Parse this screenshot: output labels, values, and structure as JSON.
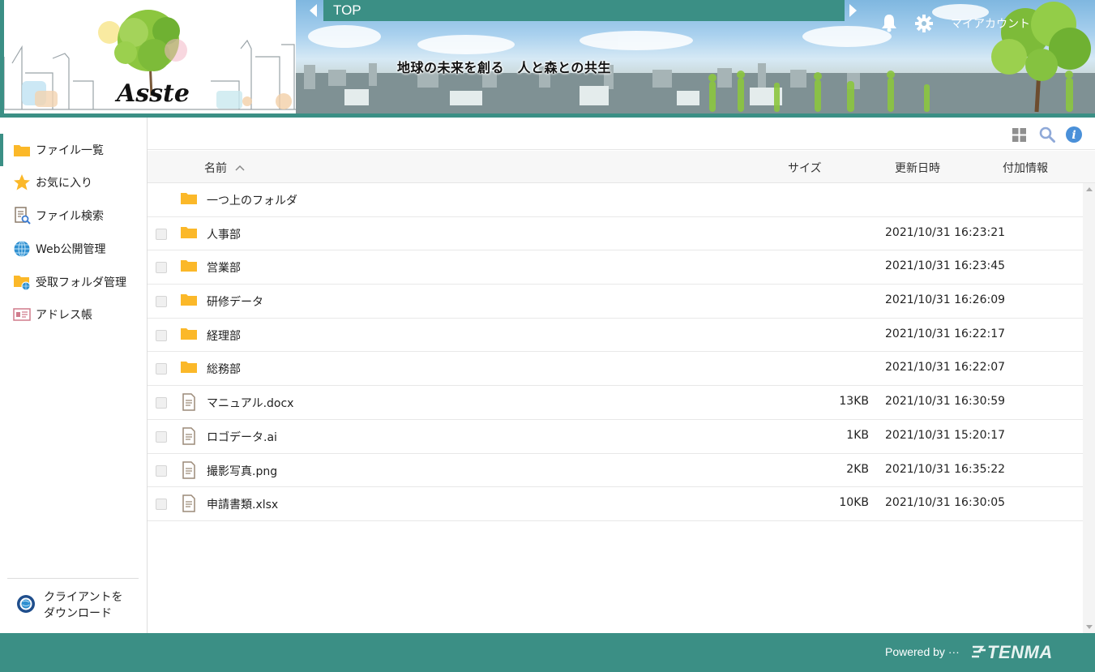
{
  "header": {
    "logo_text": "Asste",
    "nav_title": "TOP",
    "slogan": "地球の未来を創る　人と森との共生",
    "account_label": "マイアカウント"
  },
  "sidebar": {
    "items": [
      {
        "label": "ファイル一覧",
        "icon": "folder-icon"
      },
      {
        "label": "お気に入り",
        "icon": "star-icon"
      },
      {
        "label": "ファイル検索",
        "icon": "file-search-icon"
      },
      {
        "label": "Web公開管理",
        "icon": "globe-icon"
      },
      {
        "label": "受取フォルダ管理",
        "icon": "receive-folder-icon"
      },
      {
        "label": "アドレス帳",
        "icon": "address-card-icon"
      }
    ],
    "download_line1": "クライアントを",
    "download_line2": "ダウンロード"
  },
  "table": {
    "columns": {
      "name": "名前",
      "size": "サイズ",
      "date": "更新日時",
      "extra": "付加情報"
    },
    "parent_folder": "一つ上のフォルダ",
    "rows": [
      {
        "name": "人事部",
        "type": "folder",
        "size": "",
        "date": "2021/10/31 16:23:21"
      },
      {
        "name": "営業部",
        "type": "folder",
        "size": "",
        "date": "2021/10/31 16:23:45"
      },
      {
        "name": "研修データ",
        "type": "folder",
        "size": "",
        "date": "2021/10/31 16:26:09"
      },
      {
        "name": "経理部",
        "type": "folder",
        "size": "",
        "date": "2021/10/31 16:22:17"
      },
      {
        "name": "総務部",
        "type": "folder",
        "size": "",
        "date": "2021/10/31 16:22:07"
      },
      {
        "name": "マニュアル.docx",
        "type": "file",
        "size": "13KB",
        "date": "2021/10/31 16:30:59"
      },
      {
        "name": "ロゴデータ.ai",
        "type": "file",
        "size": "1KB",
        "date": "2021/10/31 15:20:17"
      },
      {
        "name": "撮影写真.png",
        "type": "file",
        "size": "2KB",
        "date": "2021/10/31 16:35:22"
      },
      {
        "name": "申請書類.xlsx",
        "type": "file",
        "size": "10KB",
        "date": "2021/10/31 16:30:05"
      }
    ]
  },
  "footer": {
    "powered_by": "Powered by ···",
    "brand": "TENMA"
  },
  "colors": {
    "accent": "#3b8f85",
    "folder": "#fbb829",
    "info": "#4a90d9"
  }
}
